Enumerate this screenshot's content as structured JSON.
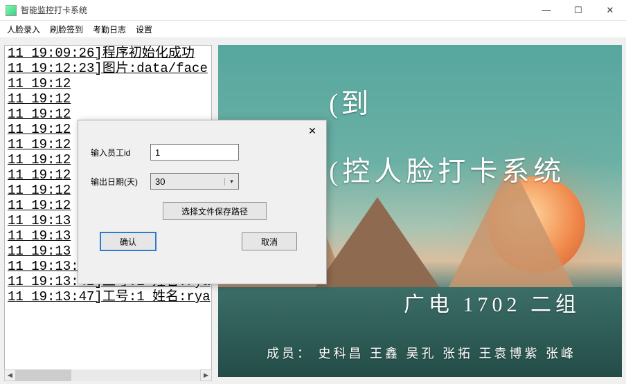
{
  "window": {
    "title": "智能监控打卡系统"
  },
  "menu": {
    "items": [
      "人脸录入",
      "刷脸签到",
      "考勤日志",
      "设置"
    ]
  },
  "log": {
    "lines": [
      "11 19:09:26]程序初始化成功",
      "11 19:12:23]图片:data/face",
      "11 19:12",
      "11 19:12",
      "11 19:12",
      "11 19:12",
      "11 19:12",
      "11 19:12",
      "11 19:12",
      "11 19:12",
      "11 19:12",
      "11 19:13",
      "11 19:13",
      "11 19:13",
      "11 19:13:38]工号:1 姓名:rya",
      "11 19:13:42]工号:1 姓名:rya",
      "11 19:13:47]工号:1 姓名:rya"
    ]
  },
  "banner": {
    "line1": "(到",
    "line2": "(控人脸打卡系统",
    "line3": "广电 1702 二组",
    "line4": "成员： 史科昌  王鑫  吴孔  张拓  王袁博紫  张峰"
  },
  "dialog": {
    "label_id": "输入员工id",
    "value_id": "1",
    "label_days": "输出日期(天)",
    "value_days": "30",
    "path_button": "选择文件保存路径",
    "ok": "确认",
    "cancel": "取消"
  }
}
